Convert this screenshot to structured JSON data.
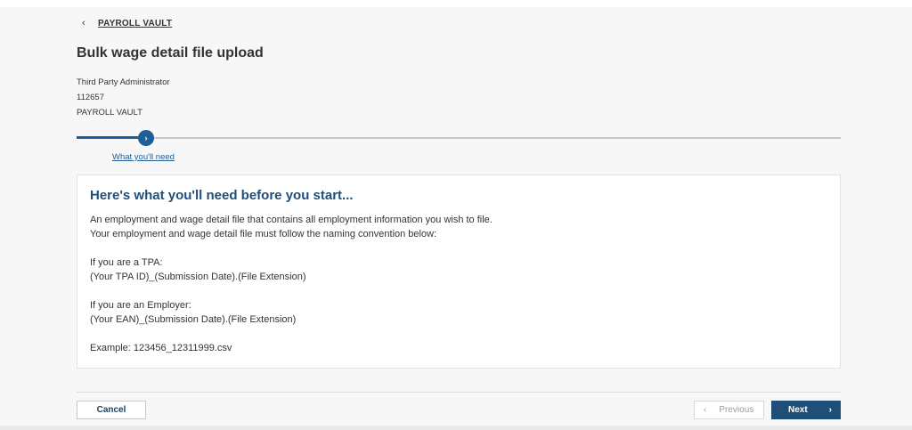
{
  "breadcrumb": {
    "back_label": "PAYROLL VAULT"
  },
  "header": {
    "title": "Bulk wage detail file upload",
    "meta": {
      "role": "Third Party Administrator",
      "id": "112657",
      "org": "PAYROLL VAULT"
    }
  },
  "stepper": {
    "current_step_label": "What you'll need",
    "current_step_index": 1,
    "icon": "chevron-right-icon"
  },
  "info": {
    "heading": "Here's what you'll need before you start...",
    "line1": "An employment and wage detail file that contains all employment information you wish to file.",
    "line2": "Your employment and wage detail file must follow the naming convention below:",
    "tpa_label": "If you are a TPA:",
    "tpa_format": "(Your TPA ID)_(Submission Date).(File Extension)",
    "employer_label": "If you are an Employer:",
    "employer_format": "(Your EAN)_(Submission Date).(File Extension)",
    "example": "Example: 123456_12311999.csv"
  },
  "footer": {
    "cancel_label": "Cancel",
    "previous_label": "Previous",
    "next_label": "Next"
  },
  "colors": {
    "primary": "#1f4e79",
    "accent": "#1f5f99",
    "background": "#f7f7f7"
  }
}
